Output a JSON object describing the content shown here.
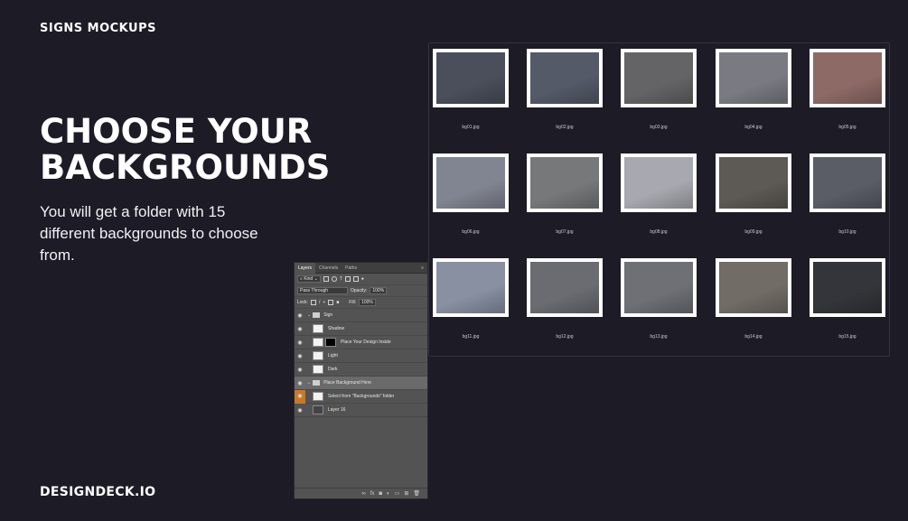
{
  "brand_top": "SIGNS MOCKUPS",
  "headline": {
    "line1": "CHOOSE YOUR",
    "line2": "BACKGROUNDS"
  },
  "subtext": "You will get a folder with 15 different backgrounds to choose from.",
  "brand_bottom": "DESIGNDECK.IO",
  "files": [
    {
      "name": "bg01.jpg",
      "color": "#4a4f5b"
    },
    {
      "name": "bg02.jpg",
      "color": "#545a68"
    },
    {
      "name": "bg03.jpg",
      "color": "#646466"
    },
    {
      "name": "bg04.jpg",
      "color": "#7a7b82"
    },
    {
      "name": "bg05.jpg",
      "color": "#8e6a66"
    },
    {
      "name": "bg06.jpg",
      "color": "#818591"
    },
    {
      "name": "bg07.jpg",
      "color": "#77787a"
    },
    {
      "name": "bg08.jpg",
      "color": "#a8a8b0"
    },
    {
      "name": "bg09.jpg",
      "color": "#5d5a55"
    },
    {
      "name": "bg10.jpg",
      "color": "#5a5d66"
    },
    {
      "name": "bg11.jpg",
      "color": "#8890a2"
    },
    {
      "name": "bg12.jpg",
      "color": "#6b6c72"
    },
    {
      "name": "bg13.jpg",
      "color": "#6e7076"
    },
    {
      "name": "bg14.jpg",
      "color": "#716c66"
    },
    {
      "name": "bg15.jpg",
      "color": "#34353a"
    }
  ],
  "ps": {
    "tabs": [
      "Layers",
      "Channels",
      "Paths"
    ],
    "menu_icon": "≡",
    "filter_kind": "Kind",
    "blend_mode": "Pass Through",
    "opacity_label": "Opacity:",
    "opacity_value": "100%",
    "lock_label": "Lock:",
    "fill_label": "Fill:",
    "fill_value": "100%",
    "layers": [
      {
        "name": "Sign",
        "type": "group"
      },
      {
        "name": "Shadow",
        "type": "layer"
      },
      {
        "name": "Place Your Design Inside",
        "type": "smart"
      },
      {
        "name": "Light",
        "type": "layer"
      },
      {
        "name": "Dark",
        "type": "layer"
      },
      {
        "name": "Place Background Here",
        "type": "group"
      },
      {
        "name": "Select from \"Backgrounds\" folder",
        "type": "layer"
      },
      {
        "name": "Layer 16",
        "type": "layer"
      }
    ],
    "footer_icons": [
      "link-icon",
      "fx-icon",
      "mask-icon",
      "adjustment-icon",
      "folder-icon",
      "new-layer-icon",
      "trash-icon"
    ]
  }
}
